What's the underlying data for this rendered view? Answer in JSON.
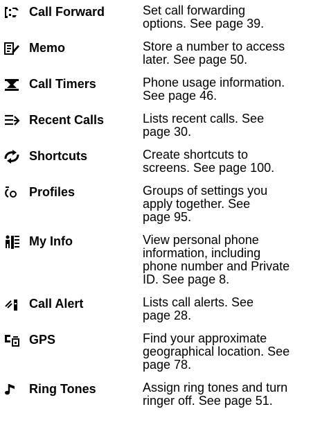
{
  "menu_items": [
    {
      "icon": "call-forward-icon",
      "name": "Call Forward",
      "description": "Set call forwarding\noptions. See page 39."
    },
    {
      "icon": "memo-icon",
      "name": "Memo",
      "description": "Store a number to access\nlater. See page 50."
    },
    {
      "icon": "call-timers-icon",
      "name": "Call Timers",
      "description": "Phone usage information.\nSee page 46."
    },
    {
      "icon": "recent-calls-icon",
      "name": "Recent Calls",
      "description": "Lists recent calls. See\npage 30."
    },
    {
      "icon": "shortcuts-icon",
      "name": "Shortcuts",
      "description": "Create shortcuts to\nscreens. See page 100."
    },
    {
      "icon": "profiles-icon",
      "name": "Profiles",
      "description": "Groups of settings you\napply together. See\npage 95."
    },
    {
      "icon": "my-info-icon",
      "name": "My Info",
      "description": "View personal phone\ninformation, including\nphone number and Private\nID. See page 8."
    },
    {
      "icon": "call-alert-icon",
      "name": "Call Alert",
      "description": "Lists call alerts. See\npage 28."
    },
    {
      "icon": "gps-icon",
      "name": "GPS",
      "description": "Find your approximate\ngeographical location. See\npage 78."
    },
    {
      "icon": "ring-tones-icon",
      "name": "Ring Tones",
      "description": "Assign ring tones and turn\nringer off. See page 51."
    }
  ]
}
